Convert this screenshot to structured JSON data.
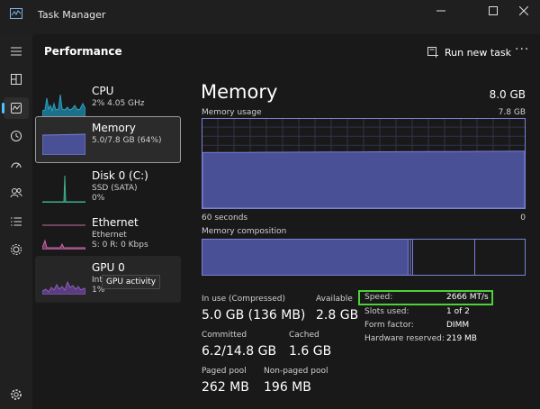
{
  "window": {
    "title": "Task Manager",
    "controls": [
      "minimize-icon",
      "maximize-icon",
      "close-icon"
    ]
  },
  "header": {
    "page_title": "Performance",
    "run_new_task": "Run new task",
    "more": "···"
  },
  "nav": {
    "items": [
      "hamburger-menu-icon",
      "processes-icon",
      "performance-icon",
      "app-history-icon",
      "startup-apps-icon",
      "users-icon",
      "details-icon",
      "services-icon"
    ],
    "settings": "settings-icon"
  },
  "cards": [
    {
      "name": "CPU",
      "sub1": "2% 4.05 GHz",
      "sub2": ""
    },
    {
      "name": "Memory",
      "sub1": "5.0/7.8 GB (64%)",
      "sub2": ""
    },
    {
      "name": "Disk 0 (C:)",
      "sub1": "SSD (SATA)",
      "sub2": "0%"
    },
    {
      "name": "Ethernet",
      "sub1": "Ethernet",
      "sub2": "S: 0 R: 0 Kbps"
    },
    {
      "name": "GPU 0",
      "sub1": "Int",
      "sub2": "1%"
    }
  ],
  "tooltip": "GPU activity",
  "memory": {
    "title": "Memory",
    "total": "8.0 GB",
    "usage_label": "Memory usage",
    "usage_max": "7.8 GB",
    "time_left": "60 seconds",
    "time_right": "0",
    "composition_label": "Memory composition",
    "usage_fraction": 0.64,
    "in_use_label": "In use (Compressed)",
    "in_use_value": "5.0 GB (136 MB)",
    "available_label": "Available",
    "available_value": "2.8 GB",
    "committed_label": "Committed",
    "committed_value": "6.2/14.8 GB",
    "cached_label": "Cached",
    "cached_value": "1.6 GB",
    "paged_label": "Paged pool",
    "paged_value": "262 MB",
    "nonpaged_label": "Non-paged pool",
    "nonpaged_value": "196 MB",
    "speed_label": "Speed:",
    "speed_value": "2666 MT/s",
    "slots_label": "Slots used:",
    "slots_value": "1 of 2",
    "form_label": "Form factor:",
    "form_value": "DIMM",
    "hw_label": "Hardware reserved:",
    "hw_value": "219 MB"
  },
  "colors": {
    "accent": "#4cc2ff",
    "memory_fill": "#4a5096",
    "memory_line": "#7a80d8",
    "cpu": "#2aa3c4",
    "disk": "#3fae8e",
    "ethernet": "#c76aa8",
    "gpu": "#8a5fb8",
    "highlight": "#4cd137"
  }
}
